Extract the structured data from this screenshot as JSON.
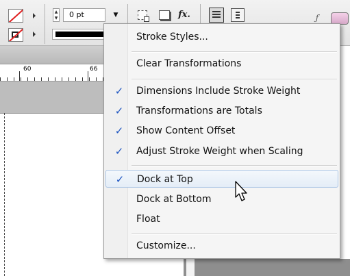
{
  "control_bar": {
    "stroke_weight_value": "0 pt",
    "dropdown_glyph": "▼",
    "fx_label": "fx.",
    "italic_glyph": "ƒ",
    "icons": [
      "fill-swatch-icon",
      "stroke-swatch-icon",
      "frame-fit-icon",
      "drop-shadow-icon",
      "effects-fx-icon",
      "align-left-icon",
      "text-wrap-icon",
      "italic-f-icon",
      "color-picker-icon"
    ]
  },
  "ruler": {
    "tick_labels": [
      "60",
      "66"
    ]
  },
  "menu": {
    "items": [
      {
        "label": "Stroke Styles...",
        "checked": false
      },
      {
        "label": "Clear Transformations",
        "checked": false
      },
      {
        "label": "Dimensions Include Stroke Weight",
        "checked": true
      },
      {
        "label": "Transformations are Totals",
        "checked": true
      },
      {
        "label": "Show Content Offset",
        "checked": true
      },
      {
        "label": "Adjust Stroke Weight when Scaling",
        "checked": true
      },
      {
        "label": "Dock at Top",
        "checked": true,
        "highlighted": true
      },
      {
        "label": "Dock at Bottom",
        "checked": false
      },
      {
        "label": "Float",
        "checked": false
      },
      {
        "label": "Customize...",
        "checked": false
      }
    ],
    "check_glyph": "✓"
  },
  "colors": {
    "check_accent": "#1f56c2",
    "highlight_border": "#aac4e4",
    "swatch_slash": "#e02020"
  }
}
